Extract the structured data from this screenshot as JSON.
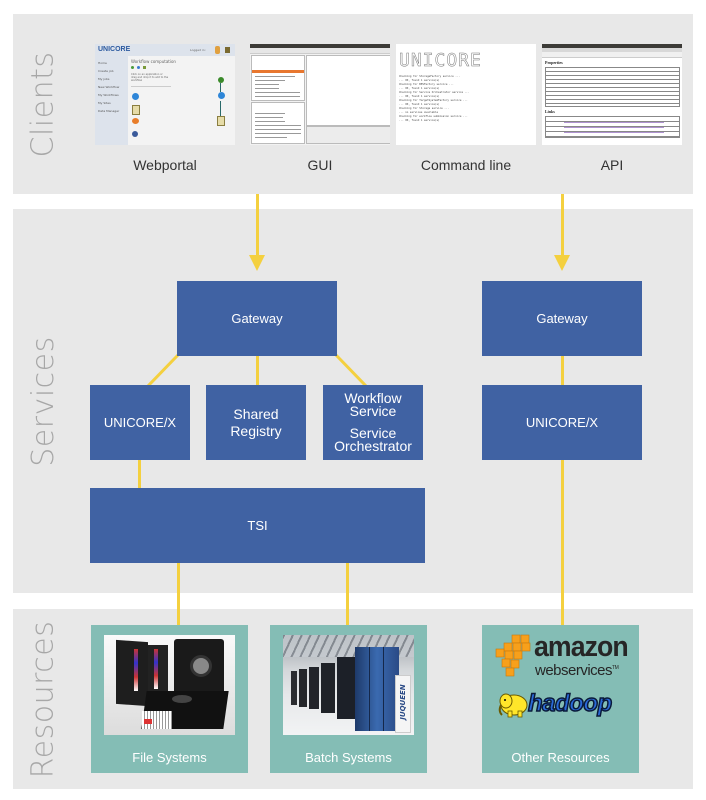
{
  "colors": {
    "band": "#e8e8e8",
    "service_box": "#4062a3",
    "connector": "#f4d03f",
    "resource_box": "#84bdb5",
    "band_label": "#a7a7a7"
  },
  "bands": {
    "clients": "Clients",
    "services": "Services",
    "resources": "Resources"
  },
  "clients": [
    {
      "label": "Webportal",
      "thumbnail": "webportal-screenshot"
    },
    {
      "label": "GUI",
      "thumbnail": "gui-screenshot"
    },
    {
      "label": "Command line",
      "thumbnail": "command-line-screenshot"
    },
    {
      "label": "API",
      "thumbnail": "api-screenshot"
    }
  ],
  "webportal_thumb": {
    "logo": "UNICORE",
    "logged_in": "Logged in:",
    "nav": [
      "Home",
      "Create job",
      "My jobs",
      "New Workflow",
      "My Workflows",
      "My Sites",
      "Data Manager"
    ],
    "title": "Workflow computation",
    "hint": "Click on an application or drag and drop it to add to the workflow"
  },
  "cli_thumb": {
    "banner": "UNICORE",
    "lines": [
      "Checking for StorageFactory service ...",
      "... OK, found 1 service(s)",
      "Checking for BESFactory service ...",
      "... OK, found 1 service(s)",
      "Checking for Service Orchestrator service ...",
      "... OK, found 1 service(s)",
      "Checking for TargetSystemFactory service ...",
      "... OK, found 1 service(s)",
      "Checking for Storage service ...",
      "... no services available",
      "Checking for workflow submission service ...",
      "... OK, found 1 service(s)"
    ]
  },
  "api_thumb": {
    "properties_heading": "Properties",
    "links_heading": "Links"
  },
  "services": {
    "left": {
      "gateway": "Gateway",
      "unicore_x": "UNICORE/X",
      "shared_registry": [
        "Shared",
        "Registry"
      ],
      "workflow": [
        "Workflow",
        "Service"
      ],
      "orchestrator": [
        "Service",
        "Orchestrator"
      ],
      "tsi": "TSI"
    },
    "right": {
      "gateway": "Gateway",
      "unicore_x": "UNICORE/X"
    }
  },
  "resources": [
    {
      "label": "File Systems",
      "image": "tape-cartridges-photo"
    },
    {
      "label": "Batch Systems",
      "image": "supercomputer-photo",
      "badge": "JUQUEEN"
    },
    {
      "label": "Other Resources",
      "logos": [
        "amazon web services",
        "hadoop"
      ]
    }
  ],
  "other_logos": {
    "amazon": "amazon",
    "aws_sub": "webservices",
    "tm": "TM",
    "hadoop": "hadoop"
  }
}
